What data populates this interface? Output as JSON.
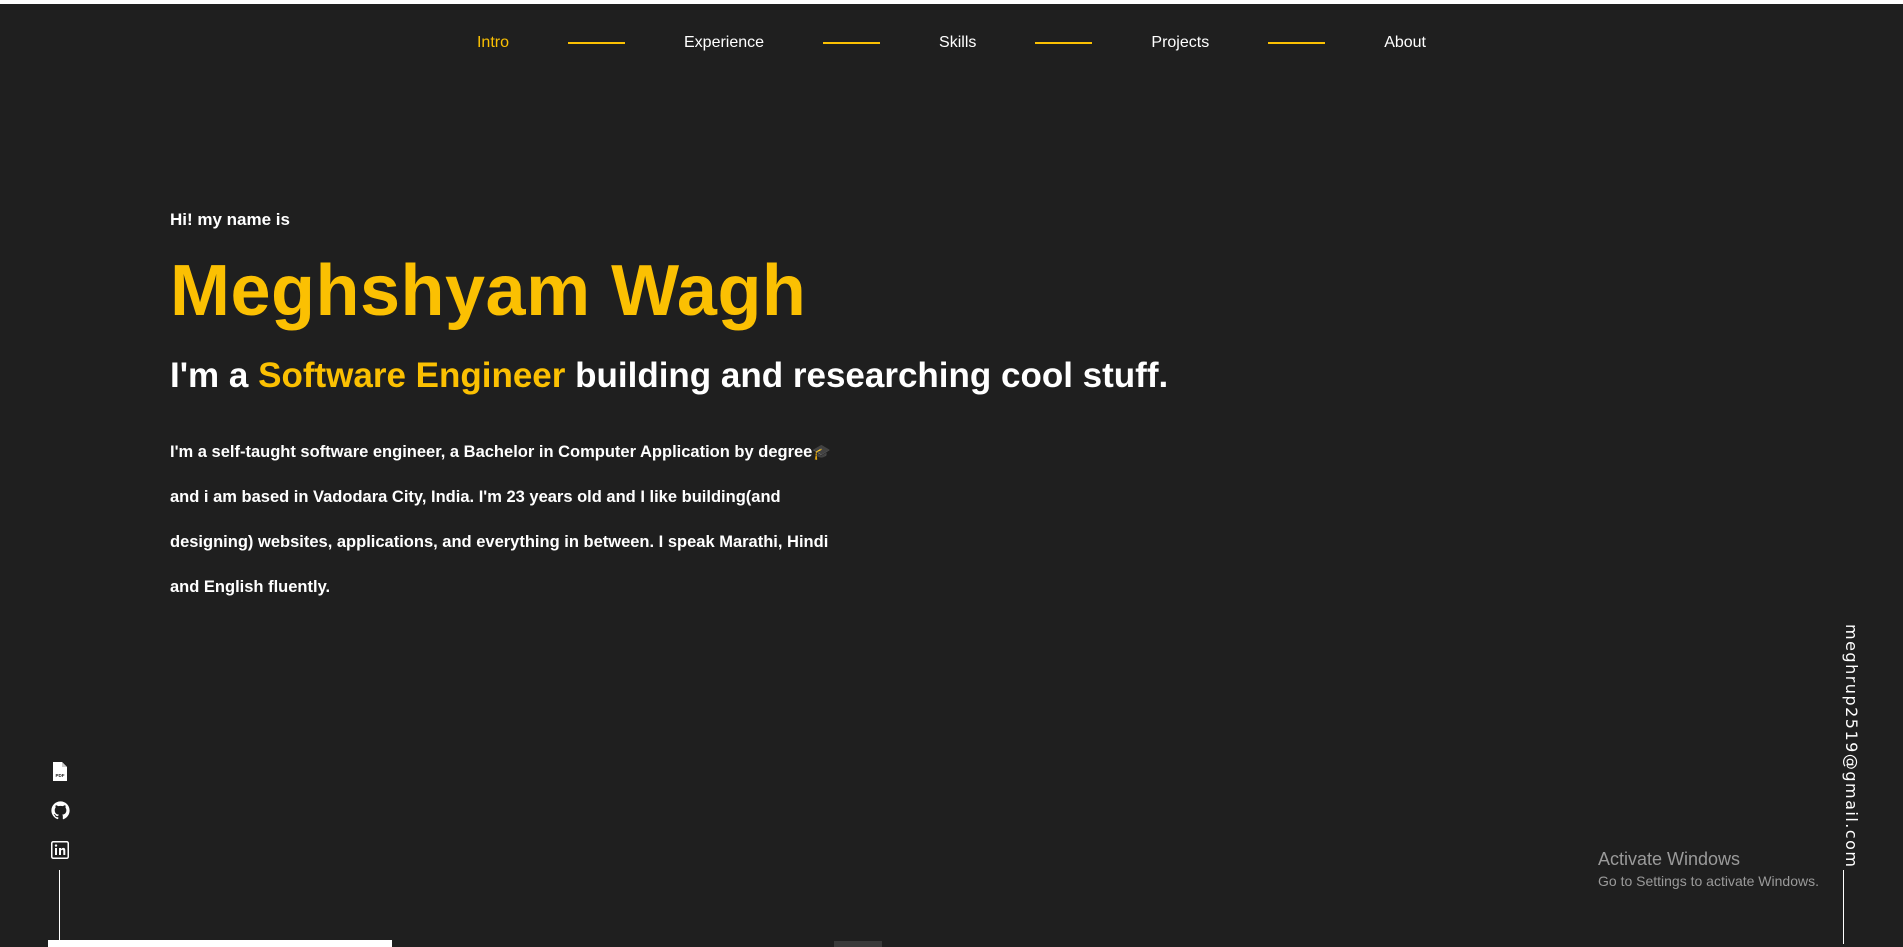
{
  "nav": {
    "items": [
      {
        "label": "Intro",
        "active": true
      },
      {
        "label": "Experience",
        "active": false
      },
      {
        "label": "Skills",
        "active": false
      },
      {
        "label": "Projects",
        "active": false
      },
      {
        "label": "About",
        "active": false
      }
    ]
  },
  "hero": {
    "greeting": "Hi! my name is",
    "name": "Meghshyam Wagh",
    "tagline_prefix": "I'm a ",
    "tagline_accent": "Software Engineer",
    "tagline_suffix": " building and researching cool stuff.",
    "bio": "I'm a self-taught software engineer, a Bachelor in Computer Application by degree",
    "bio_emoji": "🎓",
    "bio_rest": "and i am based in Vadodara City, India. I'm 23 years old and I like building(and designing) websites, applications, and everything in between. I speak Marathi, Hindi and English fluently."
  },
  "social": {
    "items": [
      {
        "icon": "pdf-resume-icon"
      },
      {
        "icon": "github-icon"
      },
      {
        "icon": "linkedin-icon"
      }
    ]
  },
  "email": "meghrup2519@gmail.com",
  "watermark": {
    "title": "Activate Windows",
    "subtitle": "Go to Settings to activate Windows."
  },
  "colors": {
    "background": "#1f1f1f",
    "accent": "#fbc002",
    "text": "#ffffff"
  }
}
